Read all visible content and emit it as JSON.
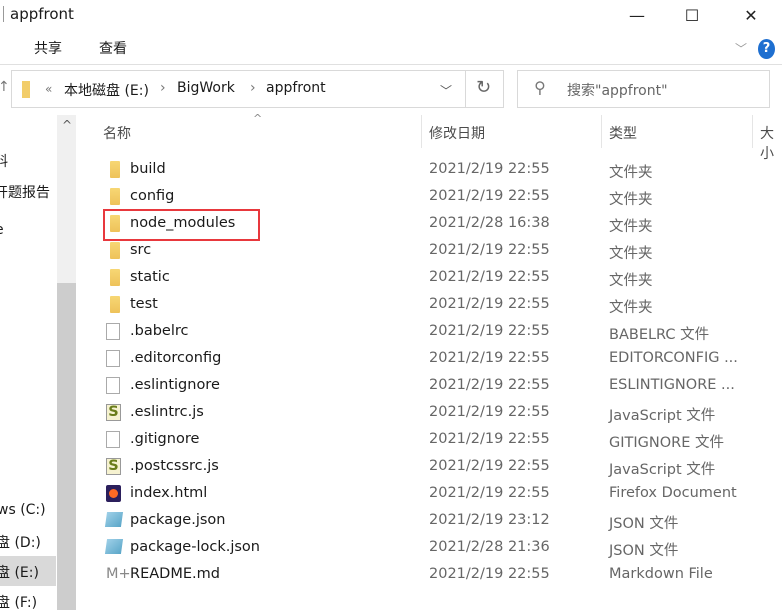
{
  "window": {
    "title": "appfront",
    "min": "—",
    "max": "☐",
    "close": "✕"
  },
  "ribbon": {
    "tabs": [
      "共享",
      "查看"
    ],
    "expand": "﹀",
    "help": "?"
  },
  "address": {
    "overflow": "«",
    "segments": [
      "本地磁盘 (E:)",
      "BigWork",
      "appfront"
    ],
    "sep": "›",
    "dropdown": "﹀",
    "refresh": "↻",
    "up": "↑"
  },
  "search": {
    "placeholder": "搜索\"appfront\"",
    "icon": "⚲"
  },
  "columns": {
    "name": "名称",
    "date": "修改日期",
    "type": "类型",
    "size": "大小",
    "sort": "^"
  },
  "sidebar": {
    "items": [
      "料",
      "开题报告",
      "e",
      "：",
      "ws (C:)",
      "盘 (D:)",
      "盘 (E:)",
      "盘 (F:)"
    ],
    "scroll_up": "^"
  },
  "files": [
    {
      "name": "build",
      "date": "2021/2/19 22:55",
      "type": "文件夹",
      "icon": "folder"
    },
    {
      "name": "config",
      "date": "2021/2/19 22:55",
      "type": "文件夹",
      "icon": "folder"
    },
    {
      "name": "node_modules",
      "date": "2021/2/28 16:38",
      "type": "文件夹",
      "icon": "folder"
    },
    {
      "name": "src",
      "date": "2021/2/19 22:55",
      "type": "文件夹",
      "icon": "folder"
    },
    {
      "name": "static",
      "date": "2021/2/19 22:55",
      "type": "文件夹",
      "icon": "folder"
    },
    {
      "name": "test",
      "date": "2021/2/19 22:55",
      "type": "文件夹",
      "icon": "folder"
    },
    {
      "name": ".babelrc",
      "date": "2021/2/19 22:55",
      "type": "BABELRC 文件",
      "icon": "doc"
    },
    {
      "name": ".editorconfig",
      "date": "2021/2/19 22:55",
      "type": "EDITORCONFIG ...",
      "icon": "doc"
    },
    {
      "name": ".eslintignore",
      "date": "2021/2/19 22:55",
      "type": "ESLINTIGNORE ...",
      "icon": "doc"
    },
    {
      "name": ".eslintrc.js",
      "date": "2021/2/19 22:55",
      "type": "JavaScript 文件",
      "icon": "js"
    },
    {
      "name": ".gitignore",
      "date": "2021/2/19 22:55",
      "type": "GITIGNORE 文件",
      "icon": "doc"
    },
    {
      "name": ".postcssrc.js",
      "date": "2021/2/19 22:55",
      "type": "JavaScript 文件",
      "icon": "js"
    },
    {
      "name": "index.html",
      "date": "2021/2/19 22:55",
      "type": "Firefox Document",
      "icon": "ff"
    },
    {
      "name": "package.json",
      "date": "2021/2/19 23:12",
      "type": "JSON 文件",
      "icon": "json"
    },
    {
      "name": "package-lock.json",
      "date": "2021/2/28 21:36",
      "type": "JSON 文件",
      "icon": "json"
    },
    {
      "name": "README.md",
      "date": "2021/2/19 22:55",
      "type": "Markdown File",
      "icon": "md"
    }
  ],
  "colors": {
    "highlight": "#e8383d",
    "selected_nav": "#d9d9d9"
  }
}
